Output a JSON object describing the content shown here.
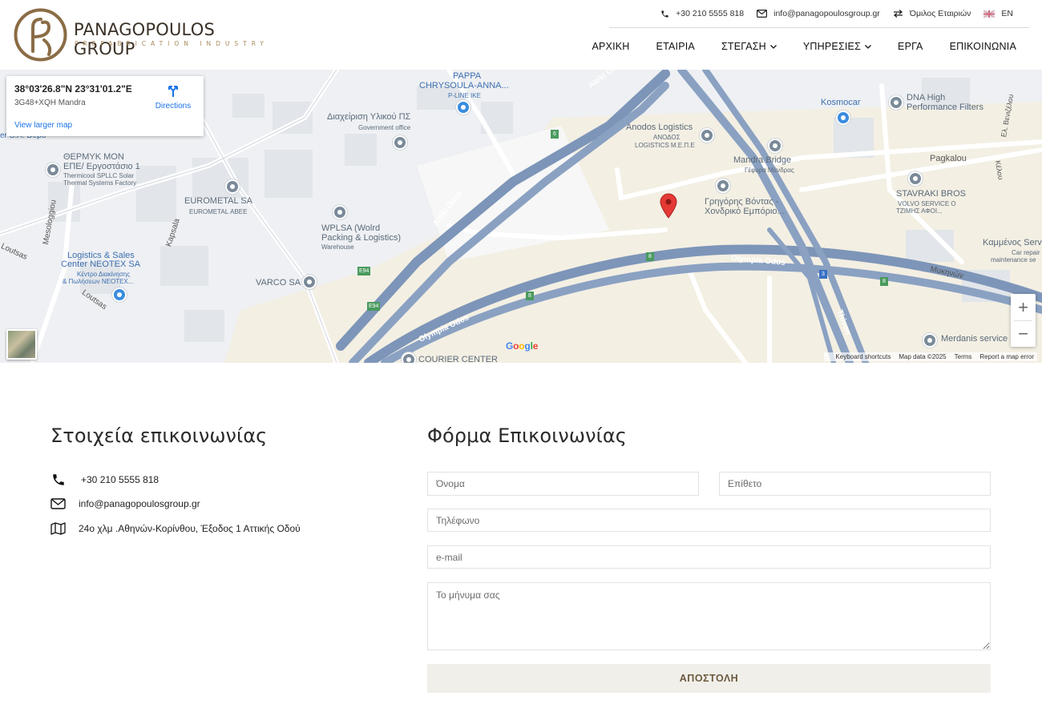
{
  "brand": {
    "name": "PANAGOPOULOS GROUP",
    "tagline": "PREFABRICATION INDUSTRY",
    "accent_color": "#a88a5c"
  },
  "topbar": {
    "phone": "+30 210 5555 818",
    "email": "info@panagopoulosgroup.gr",
    "group": "Όμιλος Εταιριών",
    "language": "EN"
  },
  "nav": {
    "items": [
      {
        "label": "ΑΡΧΙΚΗ",
        "dropdown": false
      },
      {
        "label": "ΕΤΑΙΡΙΑ",
        "dropdown": false
      },
      {
        "label": "ΣΤΕΓΑΣΗ",
        "dropdown": true
      },
      {
        "label": "ΥΠΗΡΕΣΙΕΣ",
        "dropdown": true
      },
      {
        "label": "ΕΡΓΑ",
        "dropdown": false
      },
      {
        "label": "ΕΠΙΚΟΙΝΩΝΙΑ",
        "dropdown": false
      }
    ]
  },
  "map": {
    "coords": "38°03'26.8\"N 23°31'01.2\"E",
    "plus_code": "3G48+XQH Mandra",
    "directions": "Directions",
    "view_larger": "View larger map",
    "zoom_in": "+",
    "zoom_out": "−",
    "google": "Google",
    "attribution": {
      "shortcuts": "Keyboard shortcuts",
      "data": "Map data ©2025",
      "terms": "Terms",
      "report": "Report a map error"
    },
    "labels": {
      "pappa": "PAPPA",
      "chrysoula": "CHRYSOULA-ANNA...",
      "pline": "P-LINE IKE",
      "diax": "Διαχείριση Υλικού ΠΣ",
      "gov": "Government office",
      "anodos": "Anodos Logistics",
      "anodos_sub1": "ΑΝΟΔΟΣ",
      "anodos_sub2": "LOGISTICS Μ.Ε.Π.Ε",
      "kosmocar": "Kosmocar",
      "dna1": "DNA High",
      "dna2": "Performance Filters",
      "thermyk1": "ΘΕΡΜΥΚ ΜΟΝ",
      "thermyk2": "ΕΠΕ/ Εργοστάσιο 1",
      "thermyk3": "Thermicool SPLLC Solar",
      "thermyk4": "Thermal Systems Factory",
      "eurometal": "EUROMETAL SA",
      "eurometal_sub": "EUROMETAL ΑΒΕΕ",
      "wplsa1": "WPLSA (Wolrd",
      "wplsa2": "Packing & Logistics)",
      "wplsa3": "Warehouse",
      "mandra_bridge": "Mandra Bridge",
      "mandra_bridge_sub": "Γέφυρα Μάνδρας",
      "grigoris1": "Γρηγόρης Βόντας -",
      "grigoris2": "Χονδρικό Εμπόριο...",
      "pagkalou": "Pagkalou",
      "stavraki": "STAVRAKI BROS",
      "stavraki_sub1": "VOLVO SERVICE Ο",
      "stavraki_sub2": "ΤΖΙΜΗΣ ΑΦΟΙ...",
      "kammenos": "Καμμένος Serv",
      "kammenos_sub1": "Car repair",
      "kammenos_sub2": "maintenance se",
      "mykinon": "Μυκηνών",
      "logistics1": "Logistics & Sales",
      "logistics2": "Center NEOTEX SA",
      "logistics3": "Κέντρο Διακίνησης",
      "logistics4": "& Πωλήσεων NEOTEX...",
      "varco": "VARCO SA",
      "courier": "COURIER CENTER",
      "merdanis": "Merdanis service",
      "kapsala": "Kapsala",
      "mesologgiou": "Mesologgiou",
      "loutsas1": "Loutsas",
      "loutsas2": "Loutsas",
      "attiki1": "Attiki Odos",
      "attiki2": "Attiki Odos",
      "olympia1": "Olympia Odos",
      "olympia2": "Olympia Odos",
      "thivon": "Thivon",
      "veniz": "Ελ. Βενιζέλου",
      "kelou": "Κέλου",
      "dero": "er S.A. Depo",
      "e94a": "E94",
      "e94b": "E94",
      "r6": "6",
      "r8a": "8",
      "r8b": "8",
      "r8c": "8",
      "r3": "3"
    }
  },
  "contact": {
    "title": "Στοιχεία επικοινωνίας",
    "phone": "+30 210 5555 818",
    "email": "info@panagopoulosgroup.gr",
    "address": "24ο χλμ .Αθηνών-Κορίνθου, Έξοδος 1 Αττικής Οδού"
  },
  "form": {
    "title": "Φόρμα Επικοινωνίας",
    "first_name": "Όνομα",
    "last_name": "Επίθετο",
    "phone": "Τηλέφωνο",
    "email": "e-mail",
    "message": "Το μήνυμα σας",
    "submit": "ΑΠΟΣΤΟΛΗ"
  }
}
